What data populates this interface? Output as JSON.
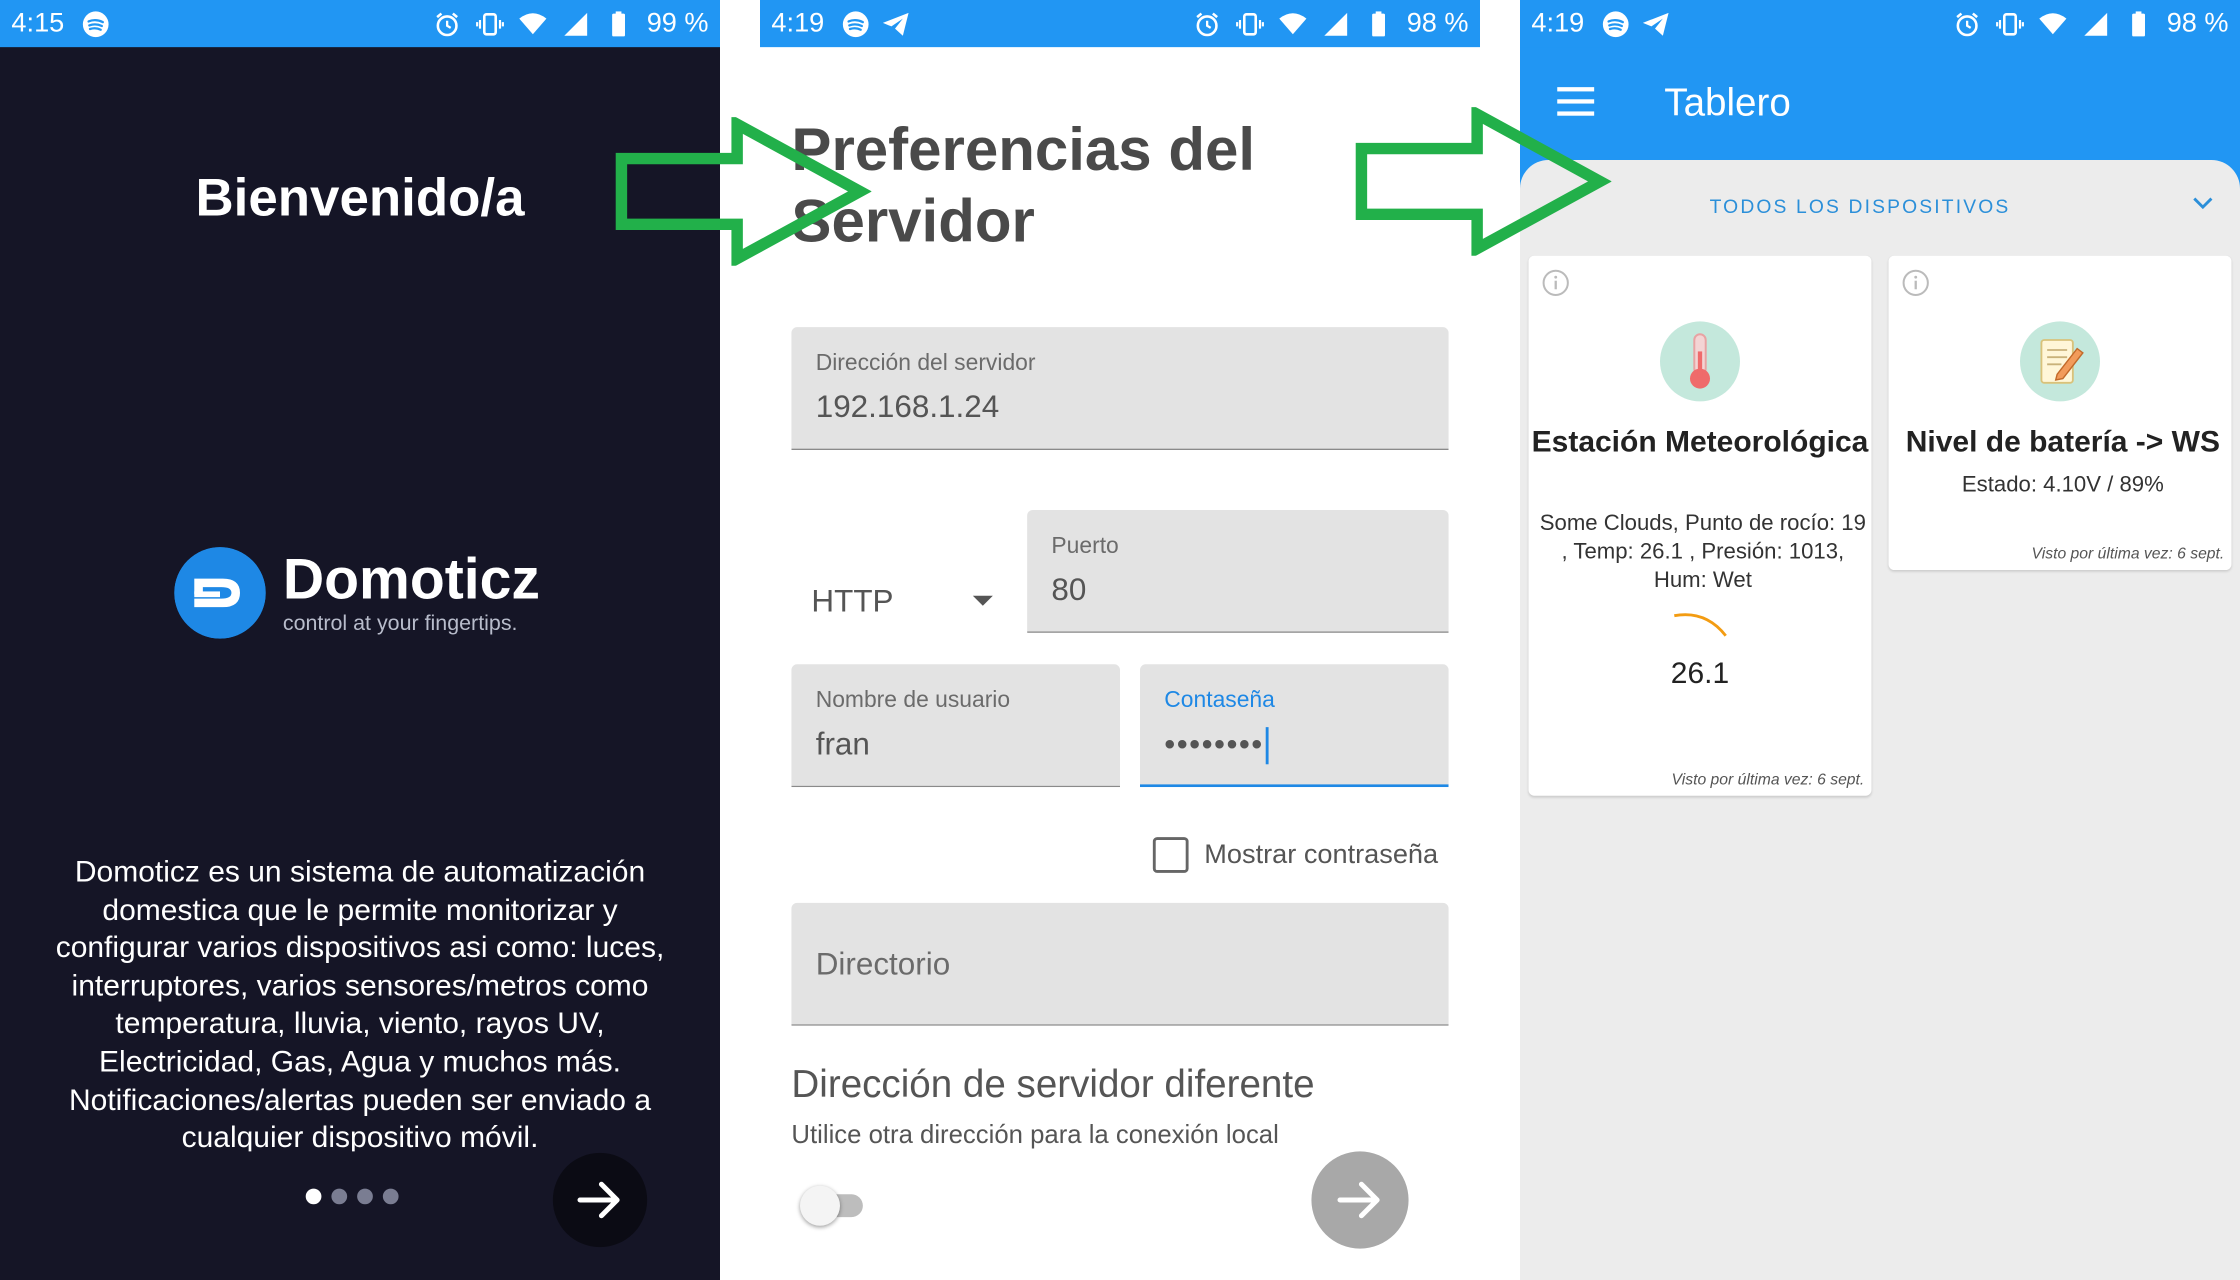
{
  "panel1": {
    "status": {
      "time": "4:15",
      "battery": "99 %"
    },
    "title": "Bienvenido/a",
    "logo": {
      "name": "Domoticz",
      "tagline": "control at your fingertips."
    },
    "description": "Domoticz es un sistema de automatización domestica que le permite monitorizar y configurar varios dispositivos asi como: luces, interruptores, varios sensores/metros como temperatura, lluvia, viento, rayos UV, Electricidad, Gas, Agua y muchos más. Notificaciones/alertas pueden ser enviado a cualquier dispositivo móvil.",
    "page_count": 4,
    "active_page": 1
  },
  "panel2": {
    "status": {
      "time": "4:19",
      "battery": "98 %"
    },
    "title": "Preferencias del Servidor",
    "server_address": {
      "label": "Dirección del servidor",
      "value": "192.168.1.24"
    },
    "protocol": {
      "value": "HTTP"
    },
    "port": {
      "label": "Puerto",
      "value": "80"
    },
    "username": {
      "label": "Nombre de usuario",
      "value": "fran"
    },
    "password": {
      "label": "Contaseña",
      "value": "••••••••"
    },
    "show_password": {
      "label": "Mostrar contraseña",
      "checked": false
    },
    "directory": {
      "placeholder": "Directorio"
    },
    "different_server": {
      "title": "Dirección de servidor diferente",
      "subtitle": "Utilice otra dirección para la conexión local",
      "enabled": false
    }
  },
  "panel3": {
    "status": {
      "time": "4:19",
      "battery": "98 %"
    },
    "title": "Tablero",
    "filter": "TODOS LOS DISPOSITIVOS",
    "devices": [
      {
        "name": "Estación Meteorológica",
        "icon": "thermometer-icon",
        "status": "Some Clouds, Punto de rocío: 19 , Temp: 26.1 , Presión: 1013, Hum: Wet",
        "value": "26.1",
        "last_seen": "Visto por última vez: 6 sept."
      },
      {
        "name": "Nivel de batería -> WS",
        "icon": "notepad-icon",
        "status": "Estado: 4.10V / 89%",
        "last_seen": "Visto por última vez: 6 sept."
      }
    ]
  },
  "colors": {
    "status_bar": "#2196f3",
    "welcome_bg": "#151526",
    "accent": "#1e88e5",
    "flow_arrow": "#22b04a",
    "dashboard_bg": "#ececec"
  }
}
